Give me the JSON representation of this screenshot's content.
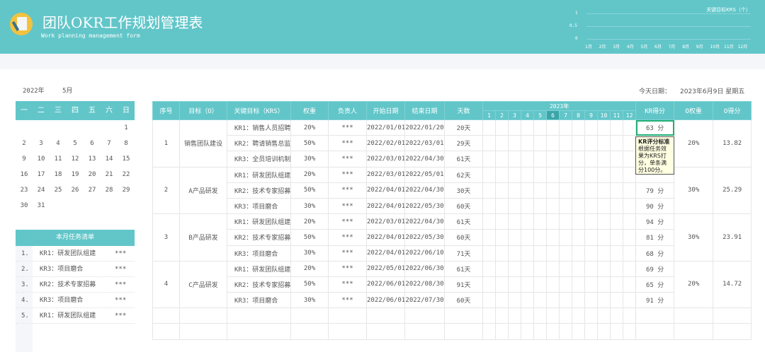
{
  "header": {
    "title": "团队OKR工作规划管理表",
    "subtitle": "Work planning management form"
  },
  "mini_chart": {
    "title": "关键目标KRS（个）",
    "y_ticks": [
      "1",
      "0.5",
      "0"
    ],
    "months": [
      "1月",
      "2月",
      "3月",
      "4月",
      "5月",
      "6月",
      "7月",
      "8月",
      "9月",
      "10月",
      "11月",
      "12月"
    ]
  },
  "calendar": {
    "year": "2022年",
    "month": "5月",
    "weekdays": [
      "一",
      "二",
      "三",
      "四",
      "五",
      "六",
      "日"
    ],
    "weeks": [
      [
        "",
        "",
        "",
        "",
        "",
        "",
        "1"
      ],
      [
        "2",
        "3",
        "4",
        "5",
        "6",
        "7",
        "8"
      ],
      [
        "9",
        "10",
        "11",
        "12",
        "13",
        "14",
        "15"
      ],
      [
        "16",
        "17",
        "18",
        "19",
        "20",
        "21",
        "22"
      ],
      [
        "23",
        "24",
        "25",
        "26",
        "27",
        "28",
        "29"
      ],
      [
        "30",
        "31",
        "",
        "",
        "",
        "",
        ""
      ]
    ]
  },
  "tasks": {
    "title": "本月任务清单",
    "items": [
      {
        "no": "1.",
        "name": "KR1：研发团队组建",
        "owner": "***"
      },
      {
        "no": "2.",
        "name": "KR3：项目磨合",
        "owner": "***"
      },
      {
        "no": "3.",
        "name": "KR2：技术专家招募",
        "owner": "***"
      },
      {
        "no": "4.",
        "name": "KR3：项目磨合",
        "owner": "***"
      },
      {
        "no": "5.",
        "name": "KR1：研发团队组建",
        "owner": "***"
      }
    ]
  },
  "today": {
    "label": "今天日期：",
    "value": "2023年6月9日 星期五"
  },
  "table": {
    "headers": [
      "序号",
      "目标（O）",
      "关键目标（KRS）",
      "权重",
      "负责人",
      "开始日期",
      "结束日期",
      "天数",
      "KR得分",
      "O权重",
      "O得分"
    ],
    "gantt_year": "2023年",
    "gantt_months": [
      "1",
      "2",
      "3",
      "4",
      "5",
      "6",
      "7",
      "8",
      "9",
      "10",
      "11",
      "12"
    ],
    "current_month": 6,
    "groups": [
      {
        "no": "1",
        "objective": "销售团队建设",
        "o_weight": "20%",
        "o_score": "13.82",
        "krs": [
          {
            "kr": "KR1：销售人员招聘",
            "weight": "20%",
            "owner": "***",
            "start": "2022/01/01",
            "end": "2022/01/20",
            "days": "20天",
            "score": "63 分"
          },
          {
            "kr": "KR2：聘请销售总监",
            "weight": "50%",
            "owner": "***",
            "start": "2022/02/01",
            "end": "2022/03/01",
            "days": "29天",
            "score": ""
          },
          {
            "kr": "KR3：全员培训机制",
            "weight": "30%",
            "owner": "***",
            "start": "2022/03/01",
            "end": "2022/04/30",
            "days": "61天",
            "score": ""
          }
        ]
      },
      {
        "no": "2",
        "objective": "A产品研发",
        "o_weight": "30%",
        "o_score": "25.29",
        "krs": [
          {
            "kr": "KR1：研发团队组建",
            "weight": "20%",
            "owner": "***",
            "start": "2022/03/01",
            "end": "2022/05/01",
            "days": "62天",
            "score": ""
          },
          {
            "kr": "KR2：技术专家招募",
            "weight": "50%",
            "owner": "***",
            "start": "2022/04/01",
            "end": "2022/04/30",
            "days": "30天",
            "score": "79 分"
          },
          {
            "kr": "KR3：项目磨合",
            "weight": "30%",
            "owner": "***",
            "start": "2022/04/01",
            "end": "2022/05/30",
            "days": "60天",
            "score": "90 分"
          }
        ]
      },
      {
        "no": "3",
        "objective": "B产品研发",
        "o_weight": "30%",
        "o_score": "23.91",
        "krs": [
          {
            "kr": "KR1：研发团队组建",
            "weight": "20%",
            "owner": "***",
            "start": "2022/03/01",
            "end": "2022/04/30",
            "days": "61天",
            "score": "94 分"
          },
          {
            "kr": "KR2：技术专家招募",
            "weight": "50%",
            "owner": "***",
            "start": "2022/04/01",
            "end": "2022/05/30",
            "days": "60天",
            "score": "81 分"
          },
          {
            "kr": "KR3：项目磨合",
            "weight": "30%",
            "owner": "***",
            "start": "2022/04/01",
            "end": "2022/06/10",
            "days": "71天",
            "score": "68 分"
          }
        ]
      },
      {
        "no": "4",
        "objective": "C产品研发",
        "o_weight": "20%",
        "o_score": "14.72",
        "krs": [
          {
            "kr": "KR1：研发团队组建",
            "weight": "20%",
            "owner": "***",
            "start": "2022/05/01",
            "end": "2022/06/30",
            "days": "61天",
            "score": "69 分"
          },
          {
            "kr": "KR2：技术专家招募",
            "weight": "50%",
            "owner": "***",
            "start": "2022/06/01",
            "end": "2022/08/30",
            "days": "91天",
            "score": "65 分"
          },
          {
            "kr": "KR3：项目磨合",
            "weight": "30%",
            "owner": "***",
            "start": "2022/06/01",
            "end": "2022/07/30",
            "days": "60天",
            "score": "91 分"
          }
        ]
      }
    ]
  },
  "tooltip": {
    "title": "KR评分标准",
    "body": "根据任务效果为KRS打分，单条满分100分。"
  }
}
